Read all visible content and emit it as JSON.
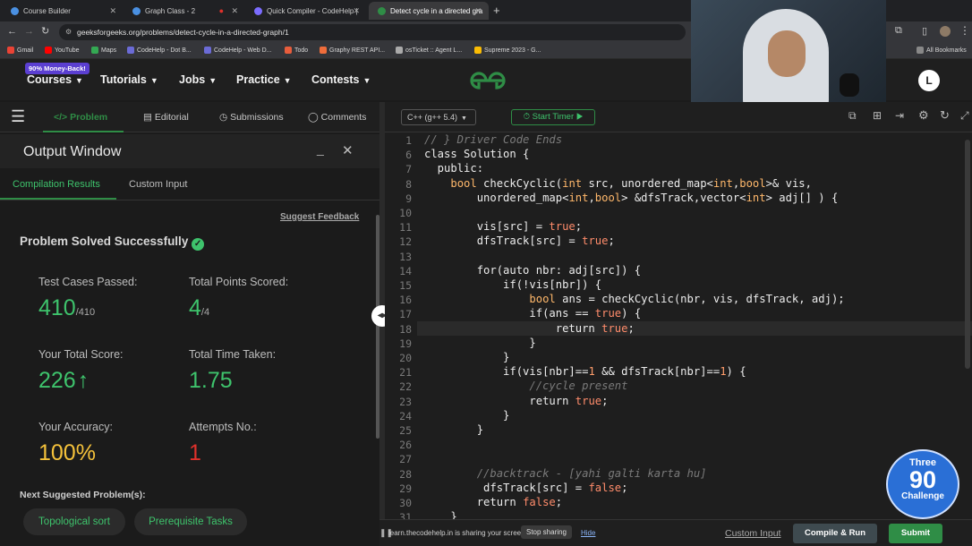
{
  "browser": {
    "tabs": [
      {
        "label": "Course Builder",
        "color": "#4a90e2"
      },
      {
        "label": "Graph Class - 2",
        "color": "#4a90e2"
      },
      {
        "label": "Quick Compiler - CodeHelp |",
        "color": "#7b6cff"
      },
      {
        "label": "Detect cycle in a directed gra",
        "color": "#2f8d46"
      }
    ],
    "url": "geeksforgeeks.org/problems/detect-cycle-in-a-directed-graph/1",
    "bookmarks": [
      "Gmail",
      "YouTube",
      "Maps",
      "CodeHelp - Dot B...",
      "CodeHelp - Web D...",
      "Todo",
      "Graphy REST API...",
      "osTicket :: Agent L...",
      "Supreme 2023 - G..."
    ],
    "all_bookmarks": "All Bookmarks"
  },
  "gfg": {
    "promo_badge": "90% Money-Back!",
    "nav": [
      "Courses",
      "Tutorials",
      "Jobs",
      "Practice",
      "Contests"
    ],
    "avatar_letter": "L"
  },
  "problem_tabs": [
    "Problem",
    "Editorial",
    "Submissions",
    "Comments"
  ],
  "output": {
    "title": "Output Window",
    "tabs": [
      "Compilation Results",
      "Custom Input"
    ],
    "suggest_feedback": "Suggest Feedback",
    "status": "Problem Solved Successfully",
    "test_cases_label": "Test Cases Passed:",
    "test_cases_value": "410",
    "test_cases_total": "/410",
    "points_label": "Total Points Scored:",
    "points_value": "4",
    "points_total": "/4",
    "score_label": "Your Total Score:",
    "score_value": "226",
    "time_label": "Total Time Taken:",
    "time_value": "1.75",
    "accuracy_label": "Your Accuracy:",
    "accuracy_value": "100%",
    "attempts_label": "Attempts No.:",
    "attempts_value": "1",
    "next_label": "Next Suggested Problem(s):",
    "next_problems": [
      "Topological sort",
      "Prerequisite Tasks"
    ]
  },
  "editor": {
    "language": "C++ (g++ 5.4)",
    "timer_label": "Start Timer",
    "lines": [
      {
        "n": "1",
        "t": "// } Driver Code Ends"
      },
      {
        "n": "6",
        "t": "class Solution {"
      },
      {
        "n": "7",
        "t": "  public:"
      },
      {
        "n": "8",
        "t": "    bool checkCyclic(int src, unordered_map<int,bool>& vis,"
      },
      {
        "n": "9",
        "t": "        unordered_map<int,bool> &dfsTrack,vector<int> adj[] ) {"
      },
      {
        "n": "10",
        "t": ""
      },
      {
        "n": "11",
        "t": "        vis[src] = true;"
      },
      {
        "n": "12",
        "t": "        dfsTrack[src] = true;"
      },
      {
        "n": "13",
        "t": ""
      },
      {
        "n": "14",
        "t": "        for(auto nbr: adj[src]) {"
      },
      {
        "n": "15",
        "t": "            if(!vis[nbr]) {"
      },
      {
        "n": "16",
        "t": "                bool ans = checkCyclic(nbr, vis, dfsTrack, adj);"
      },
      {
        "n": "17",
        "t": "                if(ans == true) {"
      },
      {
        "n": "18",
        "t": "                    return true;"
      },
      {
        "n": "19",
        "t": "                }"
      },
      {
        "n": "20",
        "t": "            }"
      },
      {
        "n": "21",
        "t": "            if(vis[nbr]==1 && dfsTrack[nbr]==1) {"
      },
      {
        "n": "22",
        "t": "                //cycle present"
      },
      {
        "n": "23",
        "t": "                return true;"
      },
      {
        "n": "24",
        "t": "            }"
      },
      {
        "n": "25",
        "t": "        }"
      },
      {
        "n": "26",
        "t": ""
      },
      {
        "n": "27",
        "t": ""
      },
      {
        "n": "28",
        "t": "        //backtrack - [yahi galti karta hu]"
      },
      {
        "n": "29",
        "t": "         dfsTrack[src] = false;"
      },
      {
        "n": "30",
        "t": "        return false;"
      },
      {
        "n": "31",
        "t": "    }"
      }
    ]
  },
  "footer": {
    "share_text": "learn.thecodehelp.in is sharing your screen.",
    "stop_sharing": "Stop sharing",
    "hide": "Hide",
    "custom_input": "Custom Input",
    "compile_run": "Compile & Run",
    "submit": "Submit"
  },
  "badge": {
    "line1": "Three",
    "line2": "90",
    "line3": "Challenge"
  },
  "colors": {
    "green": "#2f8d46",
    "success": "#3ec36c",
    "accuracy": "#f5c23b",
    "attempts": "#e0312b"
  }
}
